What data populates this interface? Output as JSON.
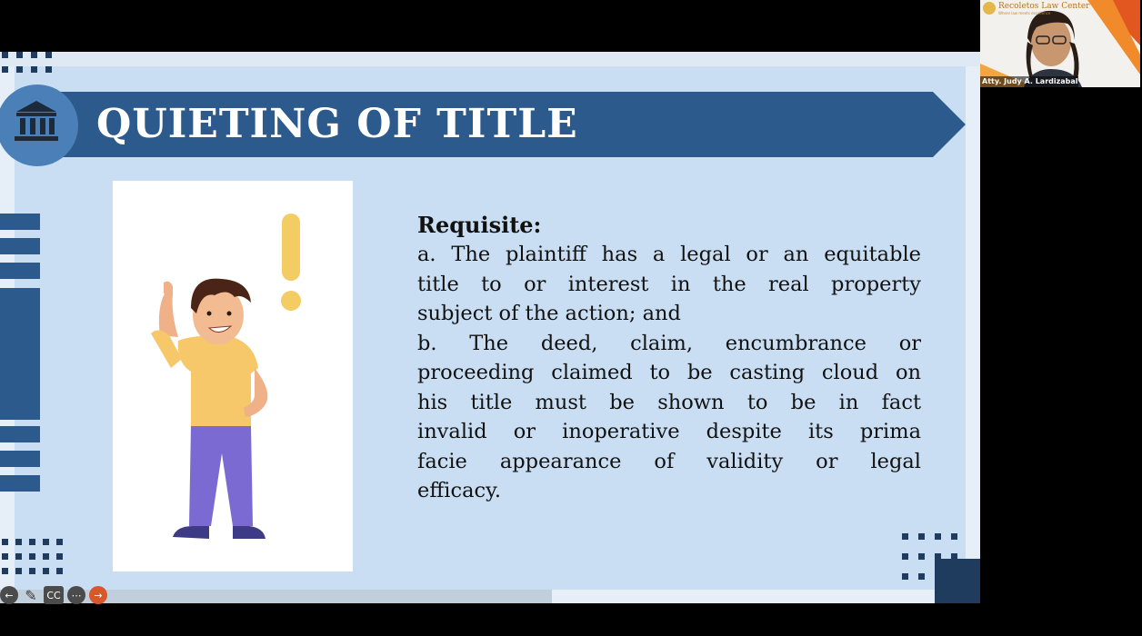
{
  "slide": {
    "title": "QUIETING OF TITLE",
    "heading": "Requisite:",
    "lines": [
      "a. The plaintiff has a legal or an equitable",
      "title to or interest in the real property",
      "subject of the action; and",
      "b. The deed, claim, encumbrance or",
      "proceeding claimed to be casting cloud on",
      "his title must be shown to be in fact",
      "invalid or inoperative despite its prima",
      "facie appearance of validity or legal",
      "efficacy."
    ]
  },
  "toolbar": {
    "back_icon": "arrow-left-icon",
    "pen_icon": "pen-icon",
    "cc_label": "CC",
    "more_icon": "more-icon",
    "next_icon": "arrow-right-icon"
  },
  "webcam": {
    "brand": "Recoletos Law Center",
    "brand_sub": "Where law meets excellence",
    "participant_name": "Atty. Judy A. Lardizabal"
  },
  "colors": {
    "banner": "#2d5a8c",
    "background": "#c9def2",
    "accent": "#d6582b"
  }
}
